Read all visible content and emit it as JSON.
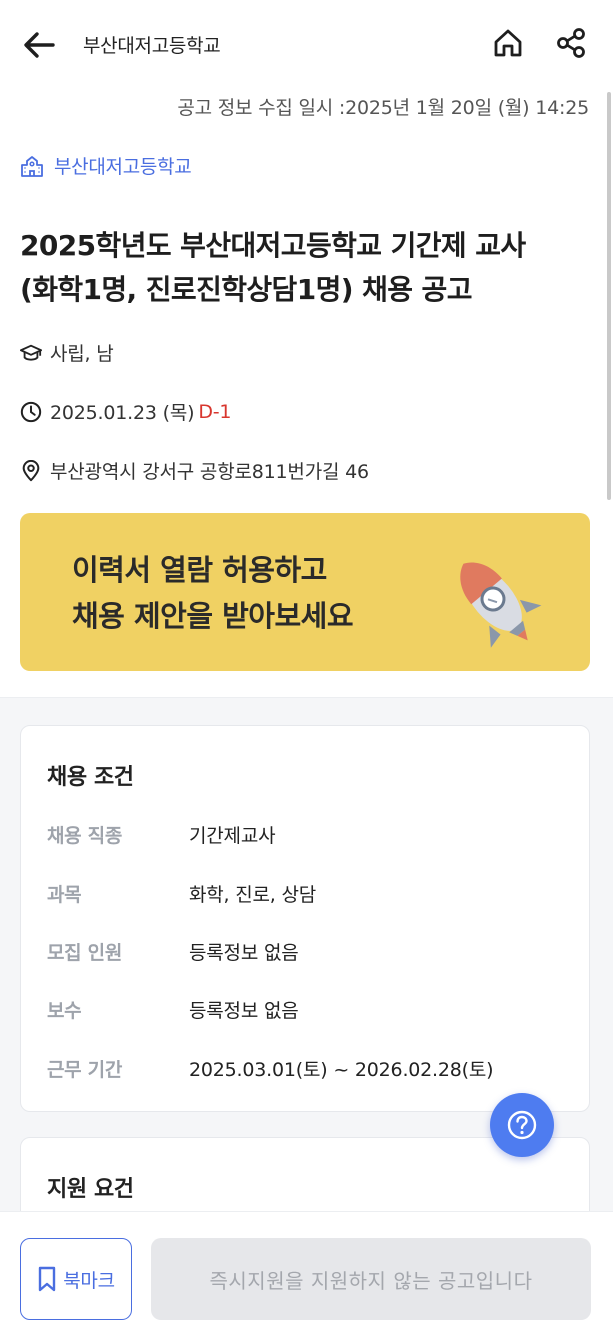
{
  "header": {
    "title": "부산대저고등학교",
    "back_icon": "arrow-left-icon",
    "home_icon": "home-icon",
    "share_icon": "share-icon"
  },
  "collected_at": "공고 정보 수집 일시 :2025년 1월 20일 (월) 14:25",
  "school": {
    "name": "부산대저고등학교",
    "icon": "school-building-icon"
  },
  "posting": {
    "title_line1": "2025학년도 부산대저고등학교 기간제 교사",
    "title_line2": "(화학1명, 진로진학상담1명) 채용 공고",
    "school_type": "사립, 남",
    "deadline": "2025.01.23 (목)",
    "dday": "D-1",
    "address": "부산광역시 강서구 공항로811번가길 46"
  },
  "banner": {
    "line1": "이력서 열람 허용하고",
    "line2": "채용 제안을 받아보세요",
    "icon": "rocket-icon"
  },
  "conditions": {
    "title": "채용 조건",
    "rows": [
      {
        "label": "채용 직종",
        "value": "기간제교사"
      },
      {
        "label": "과목",
        "value": "화학, 진로, 상담"
      },
      {
        "label": "모집 인원",
        "value": "등록정보 없음"
      },
      {
        "label": "보수",
        "value": "등록정보 없음"
      },
      {
        "label": "근무 기간",
        "value": "2025.03.01(토) ~ 2026.02.28(토)"
      }
    ]
  },
  "requirements": {
    "title": "지원 요건"
  },
  "help": {
    "icon": "question-circle-icon"
  },
  "bottom": {
    "bookmark_label": "북마크",
    "apply_label": "즉시지원을 지원하지 않는 공고입니다"
  },
  "colors": {
    "accent": "#4a6ee0",
    "dday": "#d8362e",
    "banner_bg": "#f0d163",
    "fab": "#4e7cf0"
  }
}
